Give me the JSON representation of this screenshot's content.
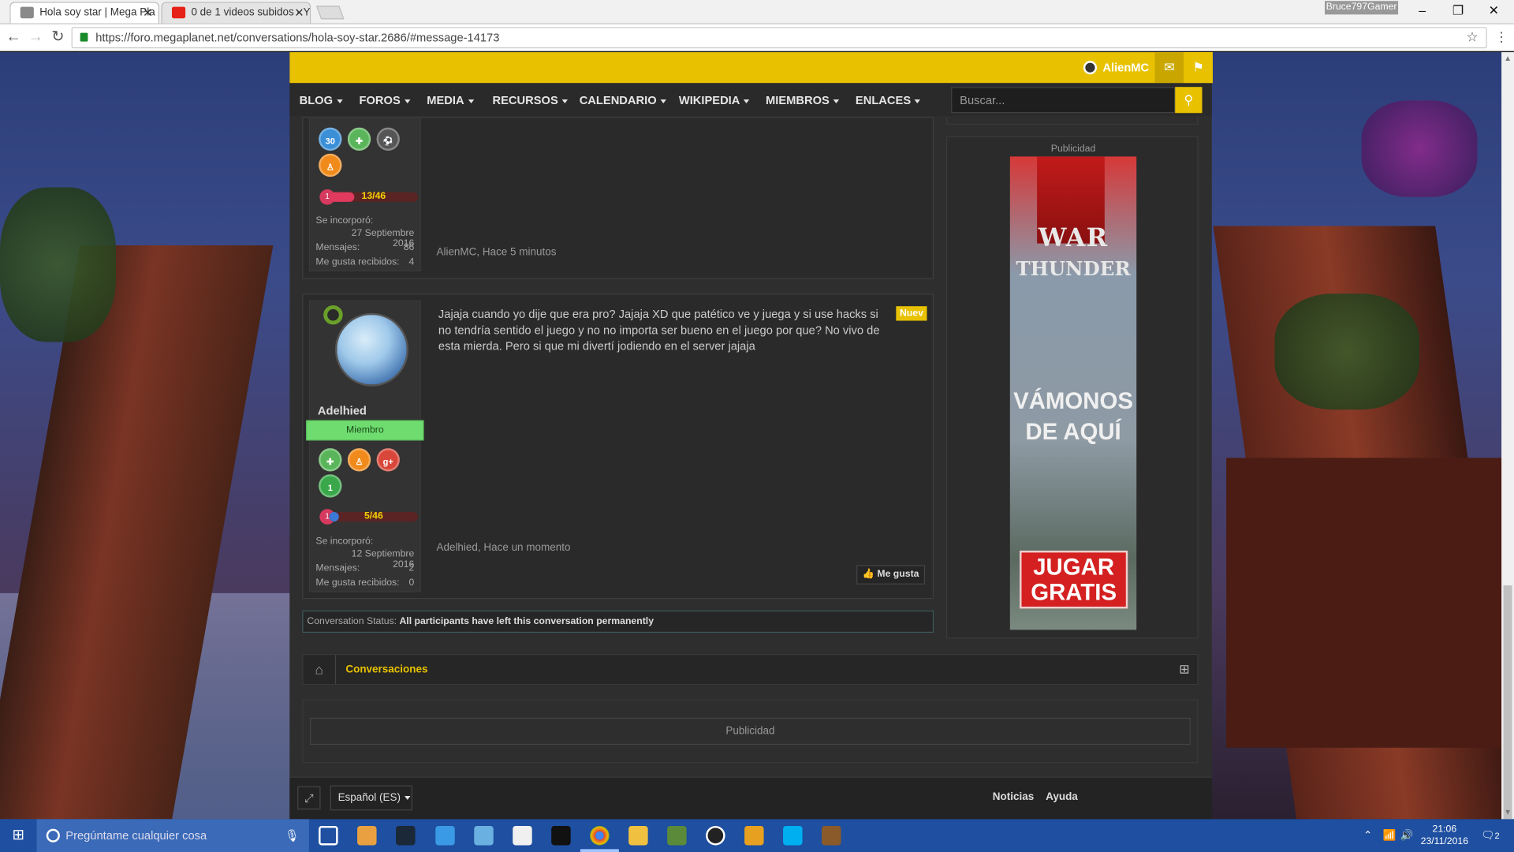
{
  "browser": {
    "tabs": [
      {
        "title": "Hola soy star | Mega Pla",
        "active": true,
        "favicon_color": "#8a8a8a"
      },
      {
        "title": "0 de 1 videos subidos - Y",
        "active": false,
        "favicon_color": "#e62117"
      }
    ],
    "windows_user": "Bruce797Gamer",
    "url": "https://foro.megaplanet.net/conversations/hola-soy-star.2686/#message-14173"
  },
  "site": {
    "top_user": "AlienMC",
    "nav": [
      {
        "label": "BLOG"
      },
      {
        "label": "FOROS"
      },
      {
        "label": "MEDIA"
      },
      {
        "label": "RECURSOS"
      },
      {
        "label": "CALENDARIO"
      },
      {
        "label": "WIKIPEDIA"
      },
      {
        "label": "MIEMBROS"
      },
      {
        "label": "ENLACES"
      }
    ],
    "search_placeholder": "Buscar...",
    "accent_color": "#e8c200"
  },
  "messages": [
    {
      "badges": [
        "30"
      ],
      "level_number": "1",
      "level_progress": "13/46",
      "stats": {
        "joined_label": "Se incorporó:",
        "joined": "27 Septiembre 2016",
        "messages_label": "Mensajes:",
        "messages": "86",
        "likes_label": "Me gusta recibidos:",
        "likes": "4"
      },
      "meta": "AlienMC, Hace 5 minutos"
    },
    {
      "username": "Adelhied",
      "role": "Miembro",
      "badges": [
        "1"
      ],
      "level_number": "1",
      "level_progress": "5/46",
      "text": "Jajaja cuando yo dije que era pro? Jajaja XD que patético ve y juega y si use hacks si no tendría sentido el juego y no no importa ser bueno en el juego por que? No vivo de esta mierda. Pero si que mi divertí jodiendo en el server jajaja",
      "new_tag": "Nuev",
      "stats": {
        "joined_label": "Se incorporó:",
        "joined": "12 Septiembre 2016",
        "messages_label": "Mensajes:",
        "messages": "2",
        "likes_label": "Me gusta recibidos:",
        "likes": "0"
      },
      "meta": "Adelhied, Hace un momento",
      "like_button": "Me gusta"
    }
  ],
  "conversation_status": {
    "label": "Conversation Status:",
    "value": "All participants have left this conversation permanently"
  },
  "sidebar": {
    "ad_label": "Publicidad",
    "ad": {
      "title_top": "WAR",
      "title_bottom": "THUNDER",
      "slogan_1": "VÁMONOS",
      "slogan_2": "DE AQUÍ",
      "cta_1": "JUGAR",
      "cta_2": "GRATIS"
    }
  },
  "breadcrumb": {
    "item": "Conversaciones"
  },
  "bottom_ad_label": "Publicidad",
  "footer": {
    "language": "Español (ES)",
    "links": [
      "Noticias",
      "Ayuda"
    ]
  },
  "taskbar": {
    "search_placeholder": "Pregúntame cualquier cosa",
    "time": "21:06",
    "date": "23/11/2016",
    "notification_count": "2"
  }
}
